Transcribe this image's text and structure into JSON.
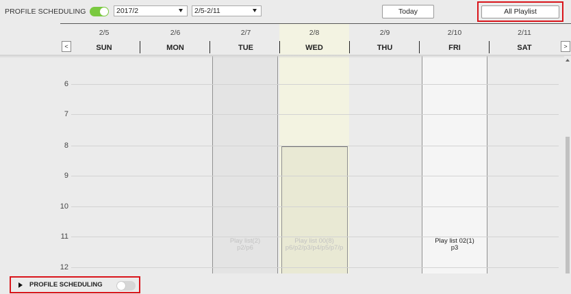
{
  "toolbar": {
    "profile_scheduling_label": "PROFILE SCHEDULING",
    "profile_scheduling_enabled": true,
    "month_select": "2017/2",
    "week_select": "2/5-2/11",
    "today_label": "Today",
    "all_playlist_label": "All Playlist"
  },
  "calendar": {
    "prev_label": "<",
    "next_label": ">",
    "days": [
      {
        "date": "2/5",
        "name": "SUN"
      },
      {
        "date": "2/6",
        "name": "MON"
      },
      {
        "date": "2/7",
        "name": "TUE"
      },
      {
        "date": "2/8",
        "name": "WED"
      },
      {
        "date": "2/9",
        "name": "THU"
      },
      {
        "date": "2/10",
        "name": "FRI"
      },
      {
        "date": "2/11",
        "name": "SAT"
      }
    ],
    "hours": [
      "6",
      "7",
      "8",
      "9",
      "10",
      "11",
      "12"
    ],
    "events": {
      "tue": {
        "line1": "Play list(2)",
        "line2": "p2/p6"
      },
      "wed": {
        "line1": "Play list 00(8)",
        "line2": "p6/p2/p3/p4/p5/p7/p"
      },
      "fri": {
        "line1": "Play list 02(1)",
        "line2": "p3"
      }
    }
  },
  "bottom": {
    "profile_scheduling_label": "PROFILE SCHEDULING",
    "profile_scheduling_enabled": false
  },
  "colors": {
    "toggle_on": "#7ac93f",
    "toggle_off": "#d6d6d6",
    "highlight_border": "#d9141a",
    "today_column": "#f3f3e1"
  }
}
